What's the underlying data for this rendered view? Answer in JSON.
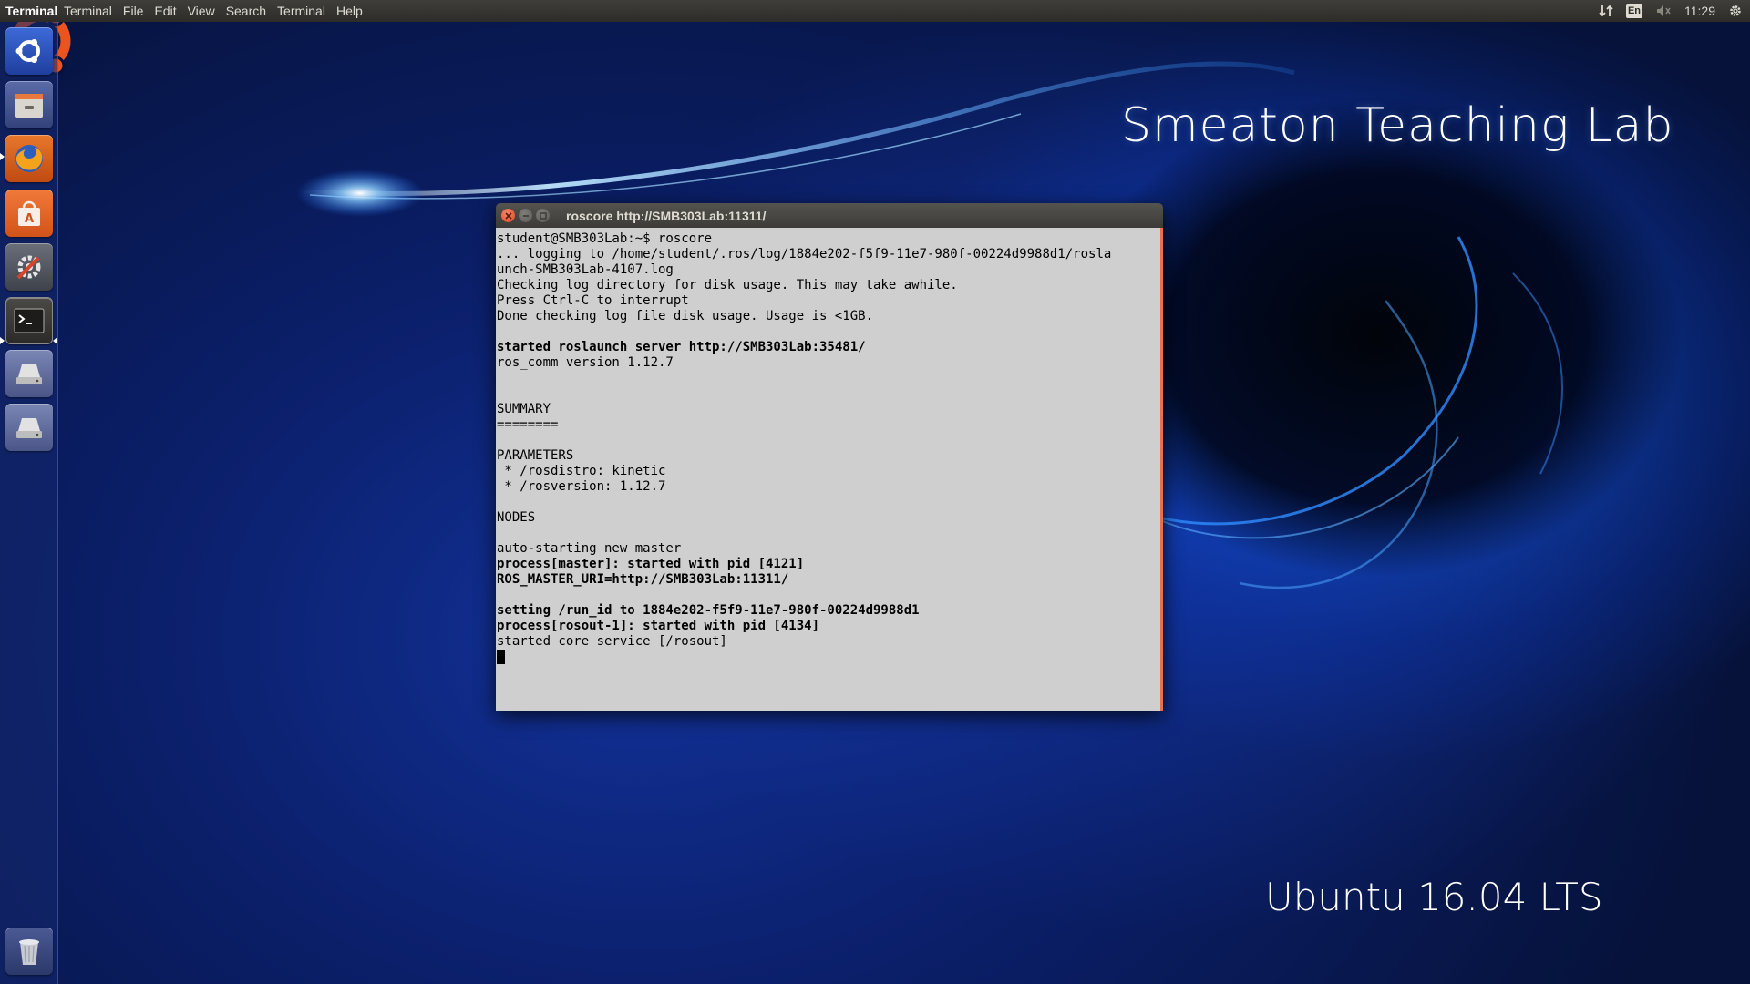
{
  "panel": {
    "app_name": "Terminal",
    "menus": [
      "Terminal",
      "File",
      "Edit",
      "View",
      "Search",
      "Terminal",
      "Help"
    ],
    "keyboard_layout": "En",
    "clock": "11:29",
    "icons": [
      "network-transfer-icon",
      "keyboard-layout-icon",
      "volume-muted-icon",
      "system-gear-icon"
    ]
  },
  "launcher": {
    "items": [
      {
        "name": "dash-home",
        "icon": "ubuntu-dash-icon"
      },
      {
        "name": "files",
        "icon": "file-cabinet-icon"
      },
      {
        "name": "firefox",
        "icon": "firefox-icon"
      },
      {
        "name": "software-center",
        "icon": "shopping-bag-icon"
      },
      {
        "name": "system-settings",
        "icon": "settings-wrench-icon"
      },
      {
        "name": "terminal",
        "icon": "terminal-icon",
        "active": true
      },
      {
        "name": "drive-1",
        "icon": "hard-drive-icon"
      },
      {
        "name": "drive-2",
        "icon": "hard-drive-icon"
      },
      {
        "name": "trash",
        "icon": "trash-icon"
      }
    ]
  },
  "wallpaper": {
    "title": "Smeaton Teaching Lab",
    "os_label": "Ubuntu 16.04 LTS",
    "logo": "ubuntu-circle-of-friends",
    "colors": {
      "deep": "#06123a",
      "glow": "#1e78ff",
      "logo": "#e95420"
    }
  },
  "terminal": {
    "title": "roscore http://SMB303Lab:11311/",
    "lines": [
      {
        "text": "student@SMB303Lab:~$ roscore",
        "bold": false
      },
      {
        "text": "... logging to /home/student/.ros/log/1884e202-f5f9-11e7-980f-00224d9988d1/rosla",
        "bold": false
      },
      {
        "text": "unch-SMB303Lab-4107.log",
        "bold": false
      },
      {
        "text": "Checking log directory for disk usage. This may take awhile.",
        "bold": false
      },
      {
        "text": "Press Ctrl-C to interrupt",
        "bold": false
      },
      {
        "text": "Done checking log file disk usage. Usage is <1GB.",
        "bold": false
      },
      {
        "text": "",
        "bold": false
      },
      {
        "text": "started roslaunch server http://SMB303Lab:35481/",
        "bold": true
      },
      {
        "text": "ros_comm version 1.12.7",
        "bold": false
      },
      {
        "text": "",
        "bold": false
      },
      {
        "text": "",
        "bold": false
      },
      {
        "text": "SUMMARY",
        "bold": false
      },
      {
        "text": "========",
        "bold": false
      },
      {
        "text": "",
        "bold": false
      },
      {
        "text": "PARAMETERS",
        "bold": false
      },
      {
        "text": " * /rosdistro: kinetic",
        "bold": false
      },
      {
        "text": " * /rosversion: 1.12.7",
        "bold": false
      },
      {
        "text": "",
        "bold": false
      },
      {
        "text": "NODES",
        "bold": false
      },
      {
        "text": "",
        "bold": false
      },
      {
        "text": "auto-starting new master",
        "bold": false
      },
      {
        "text": "process[master]: started with pid [4121]",
        "bold": true
      },
      {
        "text": "ROS_MASTER_URI=http://SMB303Lab:11311/",
        "bold": true
      },
      {
        "text": "",
        "bold": false
      },
      {
        "text": "setting /run_id to 1884e202-f5f9-11e7-980f-00224d9988d1",
        "bold": true
      },
      {
        "text": "process[rosout-1]: started with pid [4134]",
        "bold": true
      },
      {
        "text": "started core service [/rosout]",
        "bold": false
      }
    ],
    "colors": {
      "background": "#cfcfcf",
      "text": "#000000",
      "accent": "#e8704a"
    }
  }
}
